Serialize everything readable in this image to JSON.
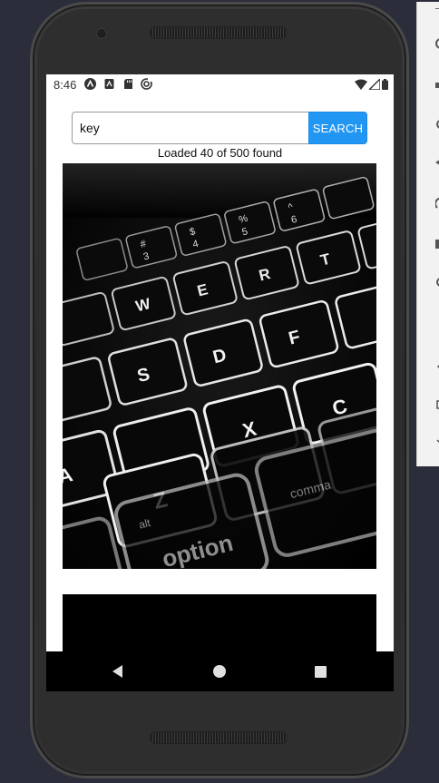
{
  "status_bar": {
    "time": "8:46",
    "left_icons": [
      "accessibility-icon",
      "sim-icon",
      "sd-card-icon",
      "sync-icon"
    ],
    "right_icons": [
      "wifi-icon",
      "signal-icon",
      "battery-icon"
    ]
  },
  "search": {
    "value": "key",
    "placeholder": "",
    "button_label": "SEARCH"
  },
  "results": {
    "summary": "Loaded 40 of 500 found",
    "items": [
      {
        "subject": "backlit laptop keyboard",
        "key_labels": [
          "#",
          "3",
          "$",
          "4",
          "%",
          "5",
          "^",
          "6",
          "W",
          "E",
          "R",
          "T",
          "S",
          "D",
          "F",
          "A",
          "X",
          "C",
          "Z",
          "alt",
          "option",
          "comma"
        ]
      },
      {
        "subject": "black image"
      }
    ]
  },
  "nav_bar": {
    "buttons": [
      "back-icon",
      "home-icon",
      "recents-icon"
    ]
  },
  "colors": {
    "accent": "#2196f3",
    "background": "#2b2d3a",
    "screen": "#ffffff",
    "nav": "#000000"
  }
}
